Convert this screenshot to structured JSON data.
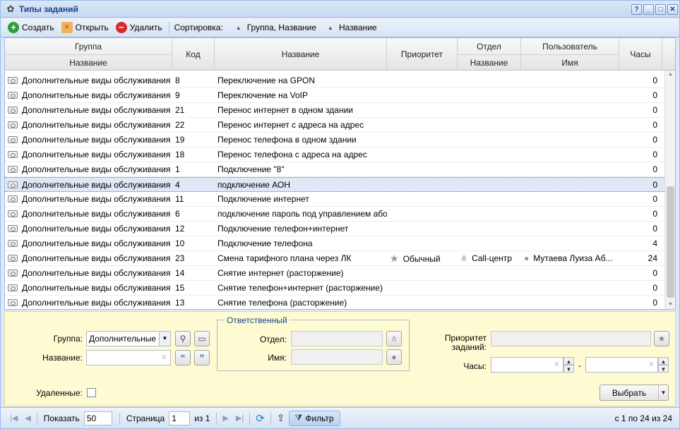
{
  "window": {
    "title": "Типы заданий",
    "buttons": [
      "?",
      "_",
      "□",
      "✕"
    ]
  },
  "toolbar": {
    "create": "Создать",
    "open": "Открыть",
    "delete": "Удалить",
    "sort_label": "Сортировка:",
    "sort1": "Группа, Название",
    "sort2": "Название"
  },
  "grid": {
    "headers": {
      "group": "Группа",
      "group_name": "Название",
      "code": "Код",
      "name": "Название",
      "priority": "Приоритет",
      "dept": "Отдел",
      "dept_name": "Название",
      "user": "Пользователь",
      "user_name": "Имя",
      "hours": "Часы"
    },
    "rows": [
      {
        "group": "Дополнительные виды обслуживания",
        "code": "8",
        "name": "Переключение на GPON",
        "priority": "",
        "dept": "",
        "user": "",
        "hours": "0"
      },
      {
        "group": "Дополнительные виды обслуживания",
        "code": "9",
        "name": "Переключение на VoIP",
        "priority": "",
        "dept": "",
        "user": "",
        "hours": "0"
      },
      {
        "group": "Дополнительные виды обслуживания",
        "code": "21",
        "name": "Перенос интернет в одном здании",
        "priority": "",
        "dept": "",
        "user": "",
        "hours": "0"
      },
      {
        "group": "Дополнительные виды обслуживания",
        "code": "22",
        "name": "Перенос интернет с адреса на адрес",
        "priority": "",
        "dept": "",
        "user": "",
        "hours": "0"
      },
      {
        "group": "Дополнительные виды обслуживания",
        "code": "19",
        "name": "Перенос телефона в одном здании",
        "priority": "",
        "dept": "",
        "user": "",
        "hours": "0"
      },
      {
        "group": "Дополнительные виды обслуживания",
        "code": "18",
        "name": "Перенос телефона с адреса на адрес",
        "priority": "",
        "dept": "",
        "user": "",
        "hours": "0"
      },
      {
        "group": "Дополнительные виды обслуживания",
        "code": "1",
        "name": "Подключение \"8\"",
        "priority": "",
        "dept": "",
        "user": "",
        "hours": "0"
      },
      {
        "group": "Дополнительные виды обслуживания",
        "code": "4",
        "name": "подключение АОН",
        "priority": "",
        "dept": "",
        "user": "",
        "hours": "0"
      },
      {
        "group": "Дополнительные виды обслуживания",
        "code": "11",
        "name": "Подключение интернет",
        "priority": "",
        "dept": "",
        "user": "",
        "hours": "0"
      },
      {
        "group": "Дополнительные виды обслуживания",
        "code": "6",
        "name": "подключение пароль под управлением або...",
        "priority": "",
        "dept": "",
        "user": "",
        "hours": "0"
      },
      {
        "group": "Дополнительные виды обслуживания",
        "code": "12",
        "name": "Подключение телефон+интернет",
        "priority": "",
        "dept": "",
        "user": "",
        "hours": "0"
      },
      {
        "group": "Дополнительные виды обслуживания",
        "code": "10",
        "name": "Подключение телефона",
        "priority": "",
        "dept": "",
        "user": "",
        "hours": "4"
      },
      {
        "group": "Дополнительные виды обслуживания",
        "code": "23",
        "name": "Смена тарифного плана через ЛК",
        "priority": "Обычный",
        "dept": "Call-центр",
        "user": "Мутаева Луиза Аб...",
        "hours": "24"
      },
      {
        "group": "Дополнительные виды обслуживания",
        "code": "14",
        "name": "Снятие интернет (расторжение)",
        "priority": "",
        "dept": "",
        "user": "",
        "hours": "0"
      },
      {
        "group": "Дополнительные виды обслуживания",
        "code": "15",
        "name": "Снятие телефон+интернет (расторжение)",
        "priority": "",
        "dept": "",
        "user": "",
        "hours": "0"
      },
      {
        "group": "Дополнительные виды обслуживания",
        "code": "13",
        "name": "Снятие телефона (расторжение)",
        "priority": "",
        "dept": "",
        "user": "",
        "hours": "0"
      }
    ],
    "selected_index": 7
  },
  "filter": {
    "group_label": "Группа:",
    "group_value": "Дополнительные в",
    "name_label": "Название:",
    "name_value": "",
    "responsible_legend": "Ответственный",
    "dept_label": "Отдел:",
    "name2_label": "Имя:",
    "priority_label": "Приоритет заданий:",
    "hours_label": "Часы:",
    "hours_sep": "-",
    "deleted_label": "Удаленные:",
    "select_button": "Выбрать"
  },
  "pager": {
    "show_label": "Показать",
    "show_value": "50",
    "page_label": "Страница",
    "page_value": "1",
    "of_label": "из 1",
    "filter_button": "Фильтр",
    "info": "с 1 по 24 из 24"
  }
}
